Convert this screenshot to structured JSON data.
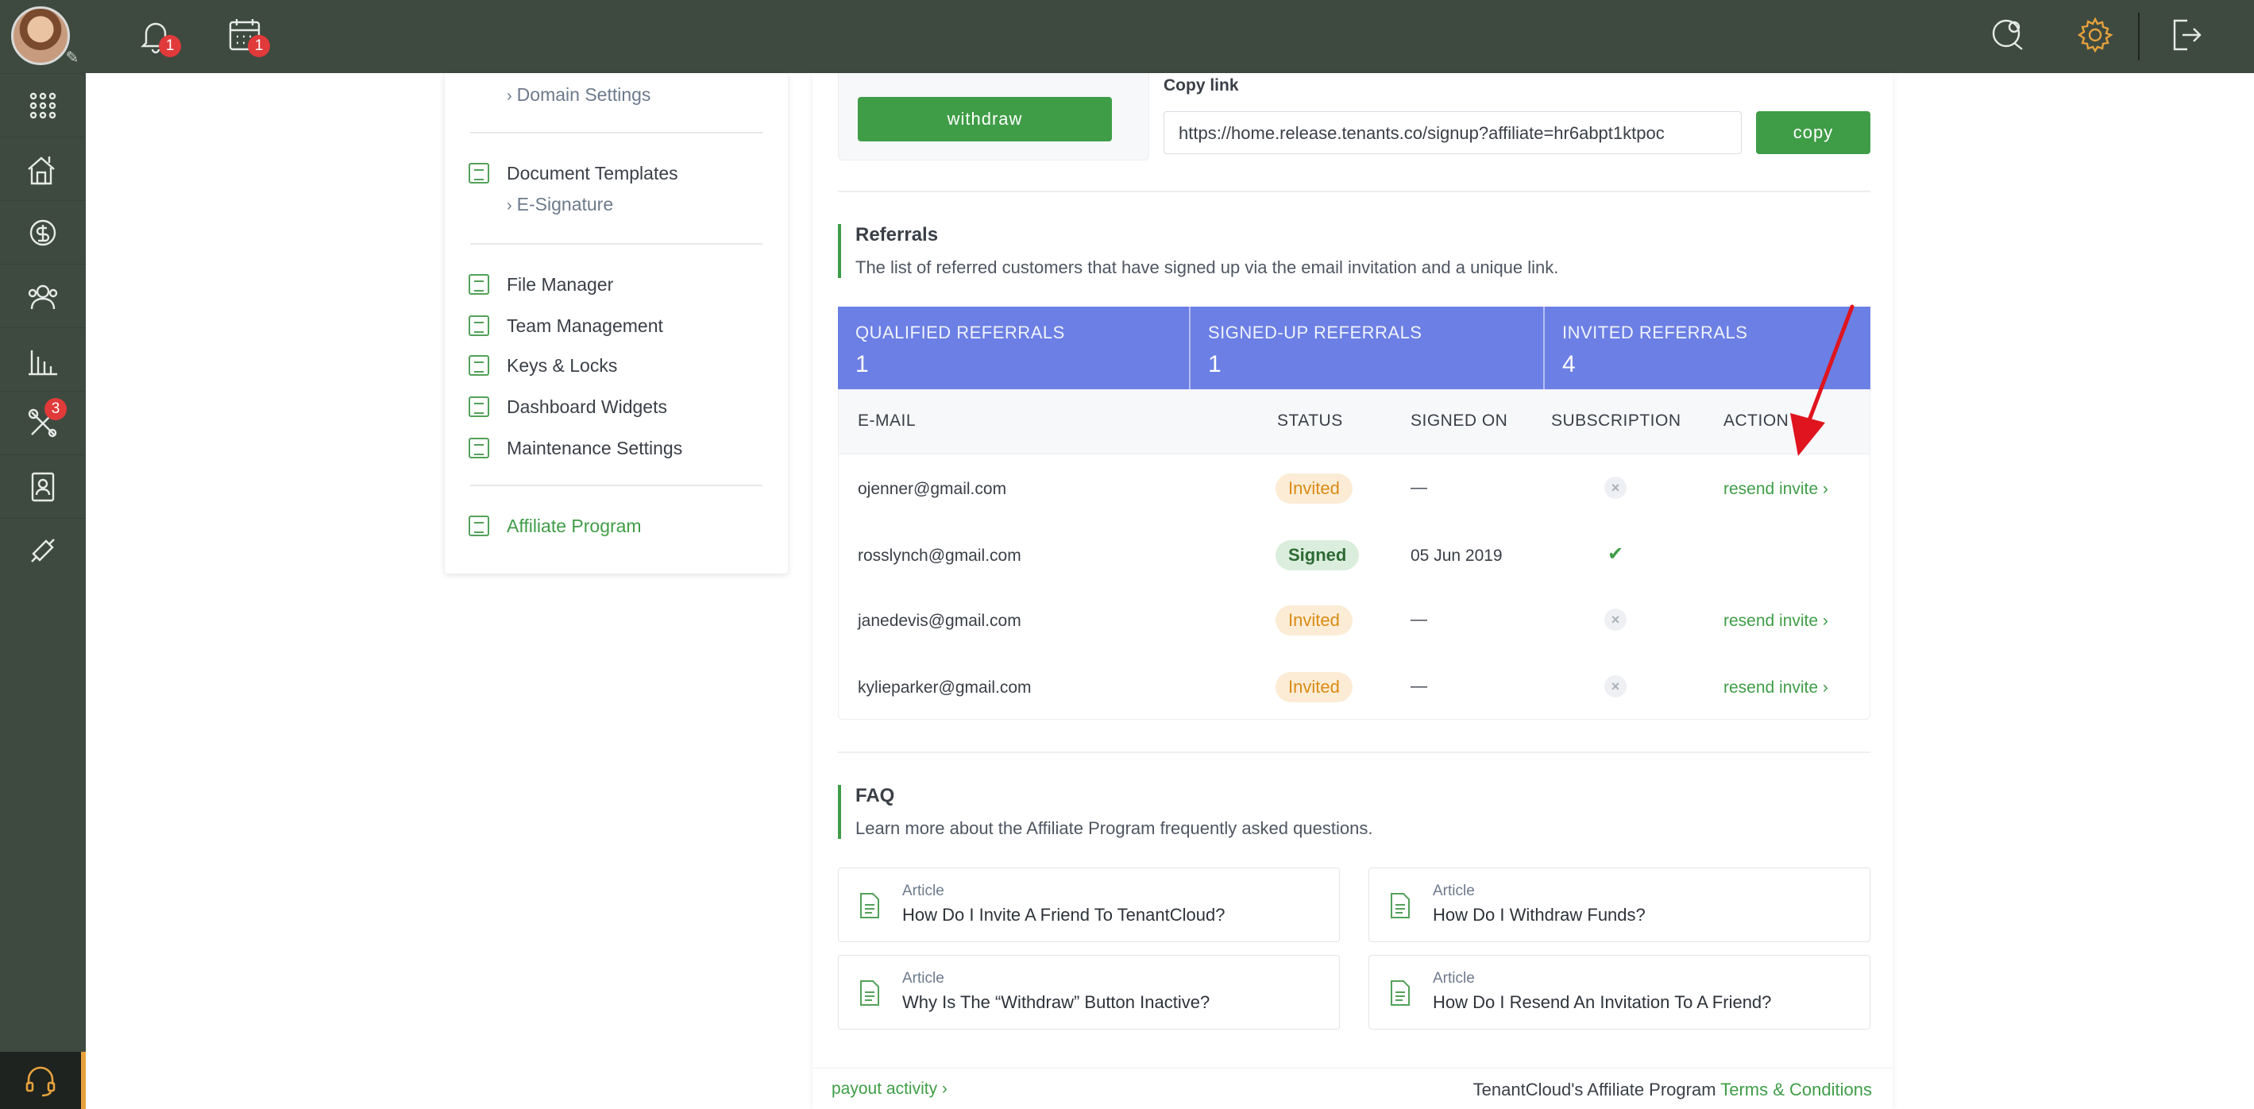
{
  "rail": {
    "avatar_alt": "user avatar",
    "items": [
      {
        "icon": "apps-grid-icon"
      },
      {
        "icon": "properties-icon"
      },
      {
        "icon": "accounting-icon"
      },
      {
        "icon": "people-icon"
      },
      {
        "icon": "reports-icon"
      },
      {
        "icon": "maintenance-icon",
        "badge": "3"
      },
      {
        "icon": "applications-icon"
      },
      {
        "icon": "integrations-icon"
      }
    ]
  },
  "topbar": {
    "notifications_badge": "1",
    "calendar_badge": "1"
  },
  "nav": {
    "domain_settings": "Domain Settings",
    "document_templates": "Document Templates",
    "e_signature": "E-Signature",
    "file_manager": "File Manager",
    "team_management": "Team Management",
    "keys_locks": "Keys & Locks",
    "dashboard_widgets": "Dashboard Widgets",
    "maintenance_settings": "Maintenance Settings",
    "affiliate_program": "Affiliate Program"
  },
  "payout": {
    "withdraw_label": "withdraw",
    "copy_link_label": "Copy link",
    "link_value": "https://home.release.tenants.co/signup?affiliate=hr6abpt1ktpoc",
    "copy_label": "copy"
  },
  "referrals": {
    "title": "Referrals",
    "description": "The list of referred customers that have signed up via the email invitation and a unique link.",
    "stats": [
      {
        "label": "QUALIFIED REFERRALS",
        "value": "1"
      },
      {
        "label": "SIGNED-UP REFERRALS",
        "value": "1"
      },
      {
        "label": "INVITED REFERRALS",
        "value": "4"
      }
    ],
    "columns": {
      "email": "E-MAIL",
      "status": "STATUS",
      "signed_on": "SIGNED ON",
      "subscription": "SUBSCRIPTION",
      "action": "ACTION"
    },
    "rows": [
      {
        "email": "ojenner@gmail.com",
        "status": "Invited",
        "signed_on": "—",
        "action": "resend invite ›"
      },
      {
        "email": "rosslynch@gmail.com",
        "status": "Signed",
        "signed_on": "05 Jun 2019",
        "action": ""
      },
      {
        "email": "janedevis@gmail.com",
        "status": "Invited",
        "signed_on": "—",
        "action": "resend invite ›"
      },
      {
        "email": "kylieparker@gmail.com",
        "status": "Invited",
        "signed_on": "—",
        "action": "resend invite ›"
      }
    ]
  },
  "faq": {
    "title": "FAQ",
    "description": "Learn more about the Affiliate Program frequently asked questions.",
    "articles": [
      {
        "kicker": "Article",
        "title": "How Do I Invite A Friend To TenantCloud?"
      },
      {
        "kicker": "Article",
        "title": "How Do I Withdraw Funds?"
      },
      {
        "kicker": "Article",
        "title": "Why Is The “Withdraw” Button Inactive?"
      },
      {
        "kicker": "Article",
        "title": "How Do I Resend An Invitation To A Friend?"
      }
    ]
  },
  "footer": {
    "payout_activity": "payout activity ›",
    "program_text": "TenantCloud's Affiliate Program ",
    "terms_link": "Terms & Conditions"
  },
  "colors": {
    "brand_green": "#3f9d47",
    "rail_dark": "#3e4a40",
    "stats_blue": "#6b7fe4",
    "invited_orange": "#d98b14",
    "annotation_red": "#e0141e"
  }
}
